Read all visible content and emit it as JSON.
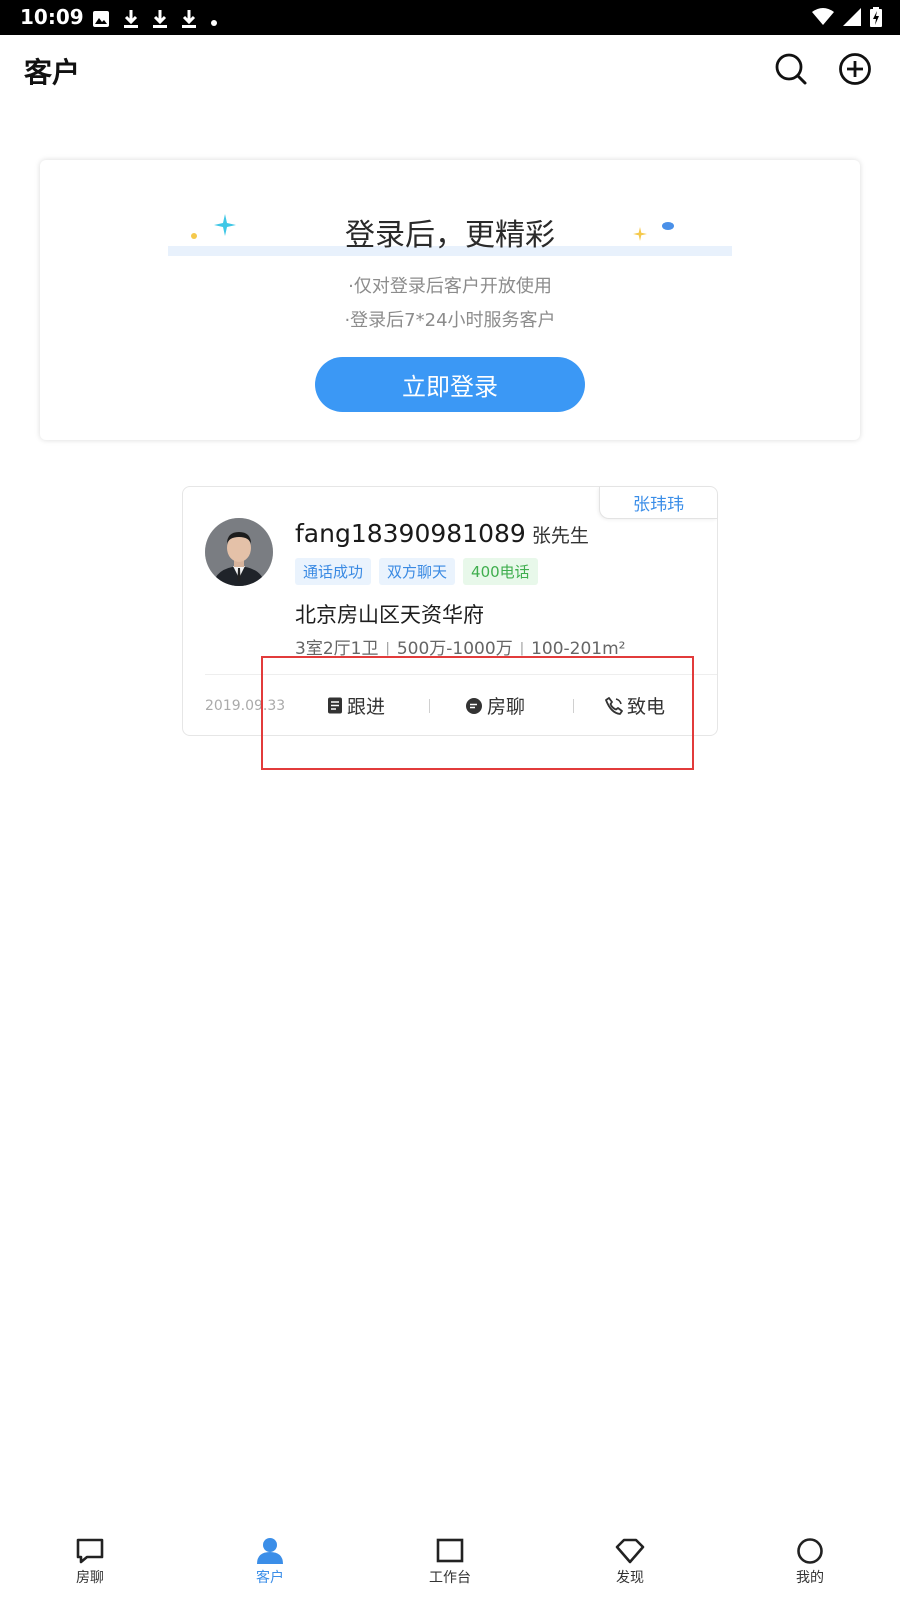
{
  "status_bar": {
    "time": "10:09",
    "icons": [
      "image-icon",
      "download-icon",
      "download-icon",
      "download-icon",
      "dot-icon",
      "wifi-icon",
      "signal-icon",
      "battery-icon"
    ]
  },
  "header": {
    "title": "客户",
    "search_icon": "search-icon",
    "add_icon": "add-circle-icon"
  },
  "login_card": {
    "title": "登录后，更精彩",
    "line1": "·仅对登录后客户开放使用",
    "line2": "·登录后7*24小时服务客户",
    "button": "立即登录"
  },
  "customer": {
    "owner": "张玮玮",
    "name": "fang18390981089",
    "salutation": "张先生",
    "tags": [
      {
        "label": "通话成功",
        "color": "#3a8ae3"
      },
      {
        "label": "双方聊天",
        "color": "#3a8ae3"
      },
      {
        "label": "400电话",
        "color": "#3fae4e"
      }
    ],
    "address": "北京房山区天资华府",
    "specs": {
      "layout": "3室2厅1卫",
      "price": "500万-1000万",
      "area": "100-201m²"
    },
    "date": "2019.09.33",
    "actions": {
      "follow": "跟进",
      "chat": "房聊",
      "call": "致电"
    }
  },
  "bottom_nav": {
    "items": [
      {
        "label": "房聊",
        "icon": "chat-bubble-icon",
        "active": false
      },
      {
        "label": "客户",
        "icon": "person-icon",
        "active": true
      },
      {
        "label": "工作台",
        "icon": "square-icon",
        "active": false
      },
      {
        "label": "发现",
        "icon": "diamond-icon",
        "active": false
      },
      {
        "label": "我的",
        "icon": "circle-icon",
        "active": false
      }
    ],
    "active_color": "#3b8ee8"
  }
}
